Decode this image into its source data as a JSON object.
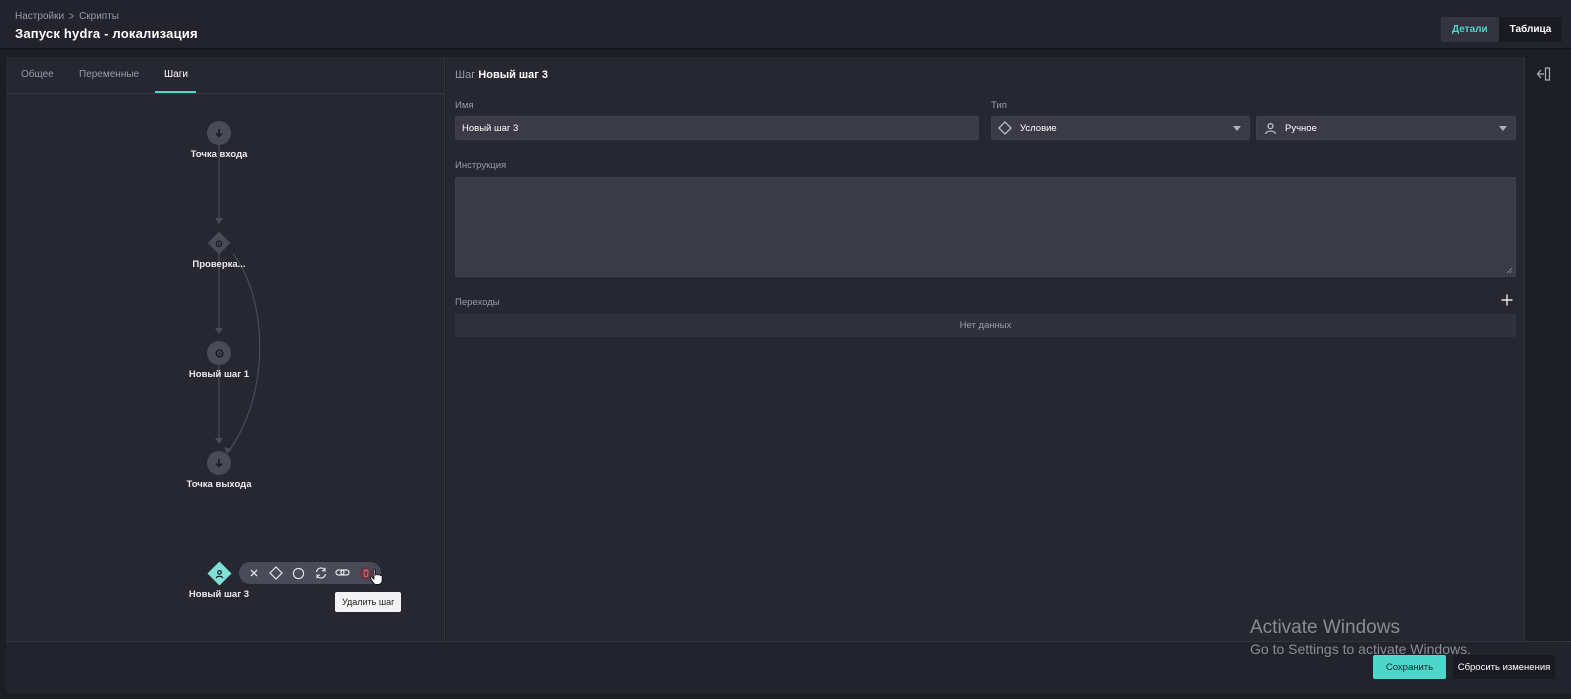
{
  "header": {
    "breadcrumb": [
      "Настройки",
      "Скрипты"
    ],
    "title": "Запуск hydra - локализация",
    "view_toggle": [
      {
        "label": "Детали",
        "active": true
      },
      {
        "label": "Таблица",
        "active": false
      }
    ]
  },
  "tabs": [
    {
      "label": "Общее",
      "active": false
    },
    {
      "label": "Переменные",
      "active": false
    },
    {
      "label": "Шаги",
      "active": true
    }
  ],
  "flow": {
    "nodes": [
      {
        "label": "Точка входа",
        "shape": "circle",
        "icon": "arrow-down-icon"
      },
      {
        "label": "Проверка...",
        "shape": "diamond",
        "icon": "gear-icon"
      },
      {
        "label": "Новый шаг 1",
        "shape": "circle",
        "icon": "gear-icon"
      },
      {
        "label": "Точка выхода",
        "shape": "circle",
        "icon": "arrow-down-icon"
      },
      {
        "label": "Новый шаг 3",
        "shape": "diamond",
        "icon": "user-icon",
        "selected": true
      }
    ],
    "toolbar": [
      "close-icon",
      "diamond-icon",
      "circle-icon",
      "refresh-icon",
      "link-icon",
      "trash-icon"
    ],
    "tooltip": "Удалить шаг"
  },
  "details": {
    "step_prefix": "Шаг",
    "step_name": "Новый шаг 3",
    "name_label": "Имя",
    "name_value": "Новый шаг 3",
    "type_label": "Тип",
    "type_value": "Условие",
    "mode_value": "Ручное",
    "instruction_label": "Инструкция",
    "transitions_label": "Переходы",
    "empty_text": "Нет данных"
  },
  "footer": {
    "save_label": "Сохранить",
    "reset_label": "Сбросить изменения"
  },
  "watermark": {
    "line1": "Activate Windows",
    "line2": "Go to Settings to activate Windows."
  },
  "colors": {
    "accent": "#4fd6cb",
    "background": "#1c1d25",
    "panel": "#262730",
    "input": "#3a3b46",
    "danger": "#e0556a"
  }
}
